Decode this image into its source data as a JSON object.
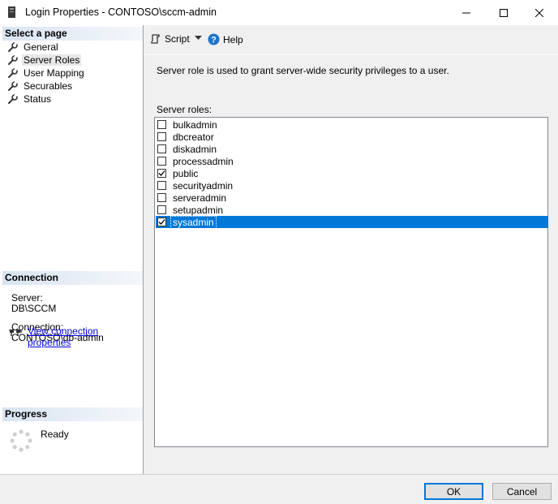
{
  "window": {
    "title": "Login Properties - CONTOSO\\sccm-admin",
    "controls": {
      "minimize": "minimize-icon",
      "maximize": "maximize-icon",
      "close": "close-icon"
    }
  },
  "left": {
    "select_page_header": "Select a page",
    "pages": [
      {
        "label": "General",
        "icon": "wrench-icon",
        "selected": false
      },
      {
        "label": "Server Roles",
        "icon": "wrench-icon",
        "selected": true
      },
      {
        "label": "User Mapping",
        "icon": "wrench-icon",
        "selected": false
      },
      {
        "label": "Securables",
        "icon": "wrench-icon",
        "selected": false
      },
      {
        "label": "Status",
        "icon": "wrench-icon",
        "selected": false
      }
    ],
    "connection_header": "Connection",
    "server_label": "Server:",
    "server_value": "DB\\SCCM",
    "connection_label": "Connection:",
    "connection_value": "CONTOSO\\db-admin",
    "view_link": "View connection properties",
    "progress_header": "Progress",
    "progress_status": "Ready"
  },
  "toolbar": {
    "script_label": "Script",
    "help_label": "Help"
  },
  "main": {
    "description": "Server role is used to grant server-wide security privileges to a user.",
    "roles_label": "Server roles:",
    "roles": [
      {
        "name": "bulkadmin",
        "checked": false,
        "selected": false
      },
      {
        "name": "dbcreator",
        "checked": false,
        "selected": false
      },
      {
        "name": "diskadmin",
        "checked": false,
        "selected": false
      },
      {
        "name": "processadmin",
        "checked": false,
        "selected": false
      },
      {
        "name": "public",
        "checked": true,
        "selected": false
      },
      {
        "name": "securityadmin",
        "checked": false,
        "selected": false
      },
      {
        "name": "serveradmin",
        "checked": false,
        "selected": false
      },
      {
        "name": "setupadmin",
        "checked": false,
        "selected": false
      },
      {
        "name": "sysadmin",
        "checked": true,
        "selected": true
      }
    ]
  },
  "buttons": {
    "ok": "OK",
    "cancel": "Cancel"
  },
  "colors": {
    "selection": "#0078d7",
    "link": "#0000ee",
    "help_icon": "#1e73c9"
  }
}
